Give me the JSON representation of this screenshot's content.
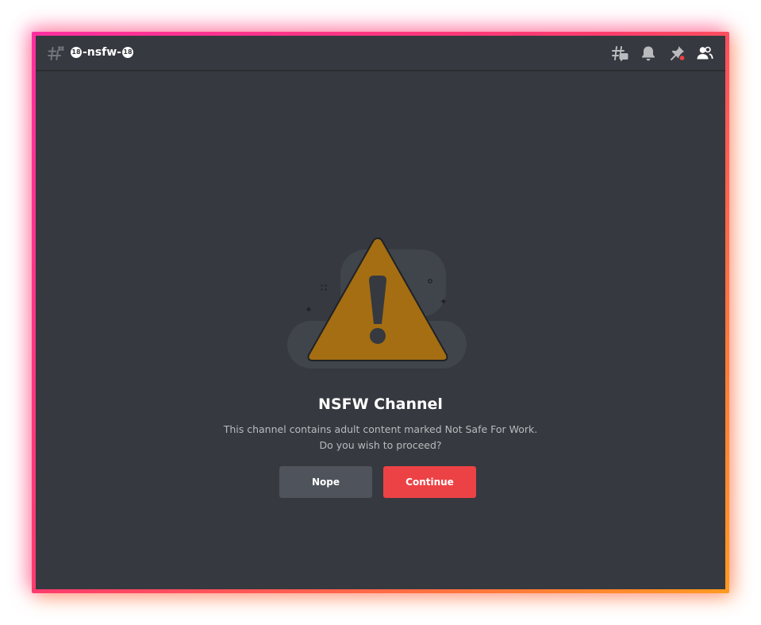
{
  "header": {
    "channel_prefix_badge": "18",
    "channel_name": "-nsfw-",
    "channel_suffix_badge": "18",
    "icons": [
      "threads-icon",
      "bell-icon",
      "pin-icon",
      "member-list-icon"
    ]
  },
  "gate": {
    "title": "NSFW Channel",
    "description_line1": "This channel contains adult content marked Not Safe For Work.",
    "description_line2": "Do you wish to proceed?",
    "nope_label": "Nope",
    "continue_label": "Continue"
  },
  "colors": {
    "background": "#36393f",
    "warning": "#a56e12",
    "nope_button": "#4f545c",
    "continue_button": "#ed4245",
    "pin_notification_dot": "#ed4245"
  }
}
